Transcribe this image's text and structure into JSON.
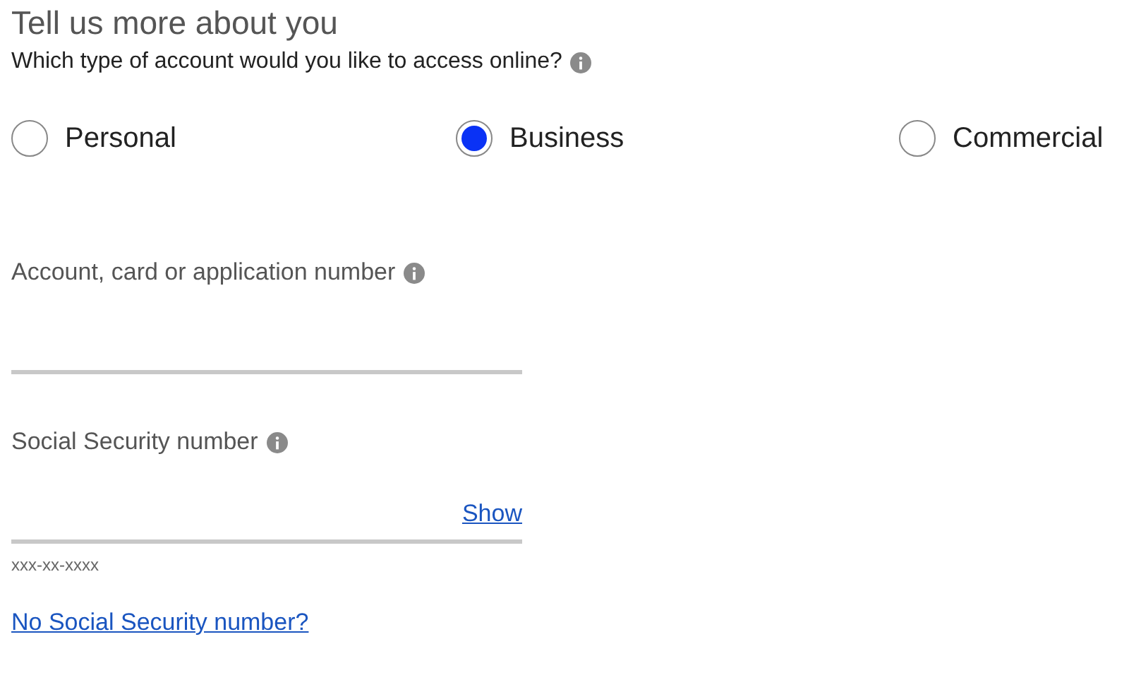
{
  "heading": "Tell us more about you",
  "question": {
    "text": "Which type of account would you like to access online?",
    "info": true
  },
  "account_types": [
    {
      "label": "Personal",
      "selected": false
    },
    {
      "label": "Business",
      "selected": true
    },
    {
      "label": "Commercial",
      "selected": false
    }
  ],
  "fields": [
    {
      "label": "Account, card or application number",
      "info": true
    },
    {
      "label": "Social Security number",
      "info": true,
      "action": "Show",
      "hint": "xxx-xx-xxxx"
    }
  ],
  "link": "No Social Security number?"
}
